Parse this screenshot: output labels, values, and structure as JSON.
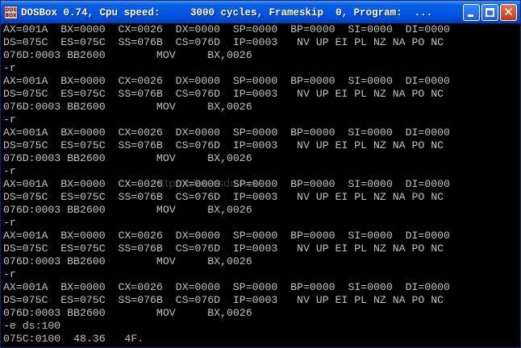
{
  "window": {
    "title": "DOSBox 0.74, Cpu speed:     3000 cycles, Frameskip  0, Program:  ...",
    "icon_label_top": "DOS",
    "icon_label_bottom": "BOX",
    "controls": {
      "minimize_icon": "minimize-icon",
      "maximize_icon": "maximize-icon",
      "close_icon": "close-icon",
      "close_glyph": "✕"
    }
  },
  "console": {
    "lines": [
      "AX=001A  BX=0000  CX=0026  DX=0000  SP=0000  BP=0000  SI=0000  DI=0000",
      "DS=075C  ES=075C  SS=076B  CS=076D  IP=0003   NV UP EI PL NZ NA PO NC",
      "076D:0003 BB2600        MOV     BX,0026",
      "-r",
      "AX=001A  BX=0000  CX=0026  DX=0000  SP=0000  BP=0000  SI=0000  DI=0000",
      "DS=075C  ES=075C  SS=076B  CS=076D  IP=0003   NV UP EI PL NZ NA PO NC",
      "076D:0003 BB2600        MOV     BX,0026",
      "-r",
      "AX=001A  BX=0000  CX=0026  DX=0000  SP=0000  BP=0000  SI=0000  DI=0000",
      "DS=075C  ES=075C  SS=076B  CS=076D  IP=0003   NV UP EI PL NZ NA PO NC",
      "076D:0003 BB2600        MOV     BX,0026",
      "-r",
      "AX=001A  BX=0000  CX=0026  DX=0000  SP=0000  BP=0000  SI=0000  DI=0000",
      "DS=075C  ES=075C  SS=076B  CS=076D  IP=0003   NV UP EI PL NZ NA PO NC",
      "076D:0003 BB2600        MOV     BX,0026",
      "-r",
      "AX=001A  BX=0000  CX=0026  DX=0000  SP=0000  BP=0000  SI=0000  DI=0000",
      "DS=075C  ES=075C  SS=076B  CS=076D  IP=0003   NV UP EI PL NZ NA PO NC",
      "076D:0003 BB2600        MOV     BX,0026",
      "-r",
      "AX=001A  BX=0000  CX=0026  DX=0000  SP=0000  BP=0000  SI=0000  DI=0000",
      "DS=075C  ES=075C  SS=076B  CS=076D  IP=0003   NV UP EI PL NZ NA PO NC",
      "076D:0003 BB2600        MOV     BX,0026",
      "-e ds:100",
      "075C:0100  48.36   4F."
    ],
    "text_color": "#c0c0c0",
    "background_color": "#000000"
  },
  "watermark": "http://blog.csdn.net/..."
}
